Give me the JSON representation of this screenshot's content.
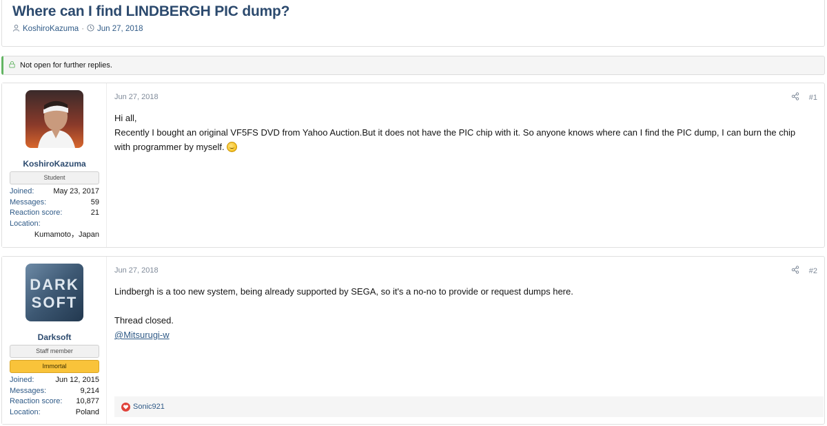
{
  "thread": {
    "title": "Where can I find LINDBERGH PIC dump?",
    "author": "KoshiroKazuma",
    "date": "Jun 27, 2018",
    "separator": "·"
  },
  "notice": {
    "text": "Not open for further replies."
  },
  "posts": [
    {
      "username": "KoshiroKazuma",
      "badges": [
        "Student"
      ],
      "stats": [
        {
          "label": "Joined:",
          "value": "May 23, 2017"
        },
        {
          "label": "Messages:",
          "value": "59"
        },
        {
          "label": "Reaction score:",
          "value": "21"
        },
        {
          "label": "Location:",
          "value": ""
        }
      ],
      "location_value": "Kumamoto，Japan",
      "date": "Jun 27, 2018",
      "number": "#1",
      "lines": [
        "Hi all,",
        "Recently I bought an original VF5FS DVD from Yahoo Auction.But it does not have the PIC chip with it. So anyone knows where can I find the PIC dump, I can burn the chip with programmer by myself."
      ]
    },
    {
      "username": "Darksoft",
      "badges": [
        "Staff member",
        "Immortal"
      ],
      "stats": [
        {
          "label": "Joined:",
          "value": "Jun 12, 2015"
        },
        {
          "label": "Messages:",
          "value": "9,214"
        },
        {
          "label": "Reaction score:",
          "value": "10,877"
        },
        {
          "label": "Location:",
          "value": "Poland"
        }
      ],
      "date": "Jun 27, 2018",
      "number": "#2",
      "lines": [
        "Lindbergh is a too new system, being already supported by SEGA, so it's a no-no to provide or request dumps here.",
        "Thread closed.",
        "@Mitsurugi-w"
      ],
      "reaction_user": "Sonic921"
    }
  ],
  "colors": {
    "title": "#2c4a6e",
    "link": "#2f5a87",
    "gold_badge": "#f9c33a",
    "notice_accent": "#63b563"
  }
}
